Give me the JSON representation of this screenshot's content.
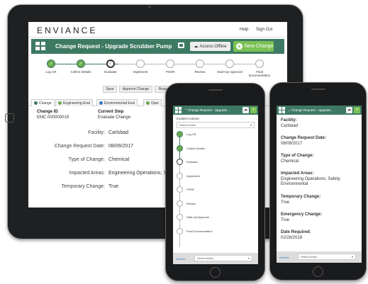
{
  "tablet": {
    "header": {
      "logo": "ENVIANCE",
      "help": "Help",
      "signout": "Sign Out"
    },
    "title": "Change Request - Upgrade Scrubber Pump",
    "offline_btn": "Access Offline",
    "new_change_btn": "New Change",
    "steps": [
      "Log CR",
      "Collect Details",
      "Evaluate",
      "Implement",
      "PSSR",
      "Review",
      "Start-Up Approval",
      "Final Documentation"
    ],
    "actions": [
      "Save",
      "Approve Change",
      "Request"
    ],
    "tabs": [
      "Change",
      "Engineering Eval",
      "Environmental Eval",
      "Oper"
    ],
    "change_id_label": "Change ID",
    "change_id": "EMC.000000019",
    "current_step_label": "Current Step",
    "current_step": "Evaluate Change",
    "fields": [
      {
        "label": "Facility:",
        "value": "Carlsbad"
      },
      {
        "label": "Change Request Date:",
        "value": "08/09/2017"
      },
      {
        "label": "Type of Change:",
        "value": "Chemical"
      },
      {
        "label": "Impacted Areas:",
        "value": "Engineering Operations; Safe"
      },
      {
        "label": "Temporary Change:",
        "value": "True"
      }
    ]
  },
  "phone1": {
    "title": "Change Request - Upgrade...",
    "incident_actions": "Incident Actions:",
    "select_action": "Select Action",
    "steps": [
      "Log CR",
      "Collect Details",
      "Evaluate",
      "Implement",
      "PSSR",
      "Review",
      "Start-Up Approval",
      "Final Documentation"
    ],
    "footer_actions": "Actions:",
    "footer_select": "Select Action"
  },
  "phone2": {
    "title": "Change Request - Upgrade...",
    "fields": [
      {
        "label": "Facility:",
        "value": "Carlsbad"
      },
      {
        "label": "Change Request Date:",
        "value": "08/09/2017"
      },
      {
        "label": "Type of Change:",
        "value": "Chemical"
      },
      {
        "label": "Impacted Areas:",
        "value": "Engineering Operations; Safety; Environmental"
      },
      {
        "label": "Temporary Change:",
        "value": "True"
      },
      {
        "label": "Emergency Change:",
        "value": "True"
      },
      {
        "label": "Date Required:",
        "value": "02/28/2018"
      }
    ],
    "footer_actions": "Actions:",
    "footer_select": "Select Action"
  },
  "colors": {
    "brand": "#3e7a63",
    "accent": "#7bc155",
    "done": "#6aaa4d"
  }
}
